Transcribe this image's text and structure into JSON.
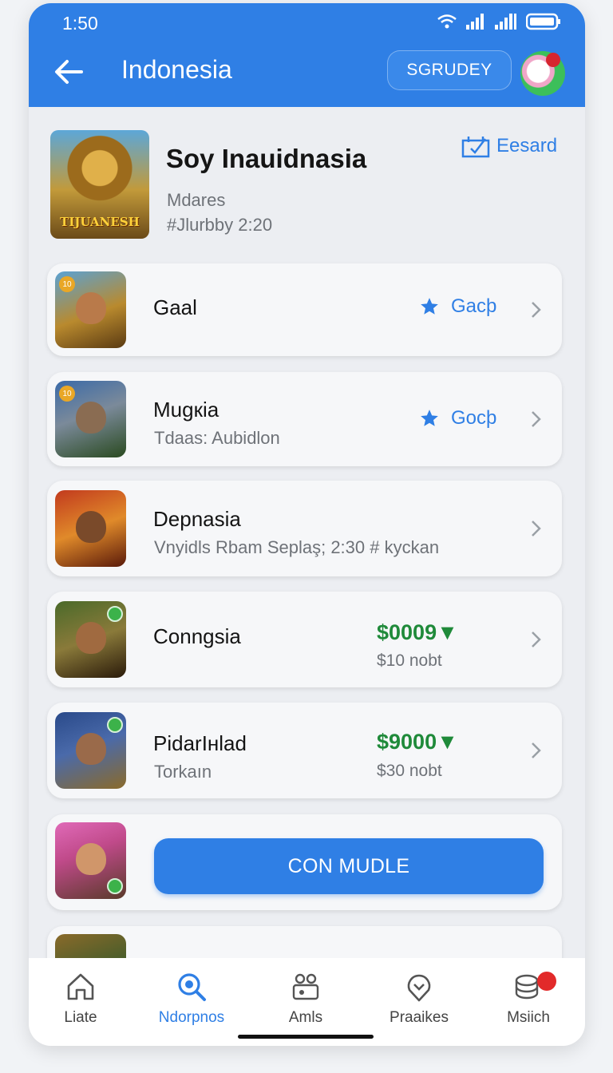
{
  "status_bar": {
    "time": "1:50"
  },
  "header": {
    "title": "Indonesia",
    "pill_label": "SGRUDEY"
  },
  "game": {
    "title": "Soy Inauidnasia",
    "subtitle": "Mdares",
    "meta": "#Jlurbby 2:20",
    "art_caption": "TIJUANESH",
    "board_link": "Eesard"
  },
  "rows": [
    {
      "title": "Gaal",
      "subtitle": "",
      "rating_label": "Gacþ",
      "badge": "10"
    },
    {
      "title": "Mugкia",
      "subtitle": "Tdaas: Aubidlon",
      "rating_label": "Gocþ",
      "badge": "10"
    },
    {
      "title": "Depnasia",
      "subtitle": "Vnyidls Rbam Seplaş; 2:30  # kyckan"
    },
    {
      "title": "Conngsia",
      "price": "$0009▼",
      "price_sub": "$10 nobt"
    },
    {
      "title": "PidarIнlad",
      "subtitle": "Torkaın",
      "price": "$9000▼",
      "price_sub": "$30 nobt"
    }
  ],
  "cta": {
    "label": "CON MUDLE"
  },
  "nav": [
    {
      "label": "Liate",
      "icon": "home-icon"
    },
    {
      "label": "Ndorpnos",
      "icon": "search-icon",
      "active": true
    },
    {
      "label": "Amls",
      "icon": "apps-icon"
    },
    {
      "label": "Praaikes",
      "icon": "favorites-icon"
    },
    {
      "label": "Msiich",
      "icon": "stack-icon"
    }
  ],
  "colors": {
    "primary": "#2f7fe5",
    "price_green": "#1f8a3a",
    "badge_red": "#e22a2a"
  }
}
